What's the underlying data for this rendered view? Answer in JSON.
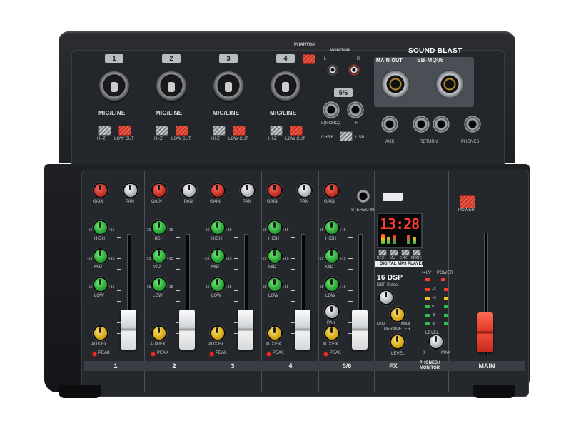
{
  "brand": {
    "name": "SOUND BLAST",
    "model": "SB-MQ06"
  },
  "channels": [
    {
      "number": "1",
      "strip_label": "1"
    },
    {
      "number": "2",
      "strip_label": "2"
    },
    {
      "number": "3",
      "strip_label": "3"
    },
    {
      "number": "4",
      "strip_label": "4"
    },
    {
      "number": "5/6",
      "strip_label": "5/6"
    }
  ],
  "top": {
    "mic_line": "MIC/LINE",
    "hi_z": "HI-Z",
    "low_cut": "LOW CUT",
    "phantom": "PHANTOM",
    "monitor": "MONITOR",
    "lr_l": "L",
    "lr_r": "R",
    "main_out": "MAIN OUT",
    "ch56": "CH5/6",
    "usb": "USB",
    "aux": "AUX",
    "return": "RETURN",
    "phones": "PHONES",
    "l_mono": "L(MONO)",
    "r": "R",
    "section_56": "5/6"
  },
  "knobs": {
    "gain": "GAIN",
    "pan": "PAN",
    "high": "HIGH",
    "mid": "MID",
    "low": "LOW",
    "aux_fx": "AUX/FX",
    "peak": "PEAK",
    "plus15": "+15",
    "minus15": "-15",
    "stereo_in": "STEREO IN",
    "power": "POWER"
  },
  "player": {
    "title": "DIGITAL MP3 PLAYER",
    "display_time": "13:28",
    "buttons": [
      "REC",
      "MU",
      "CHK",
      "MODE"
    ]
  },
  "dsp": {
    "title": "16 DSP",
    "select": "DSP Select",
    "parameter": "PARAMETER",
    "min": "MIN",
    "max": "MAX",
    "level": "LEVEL",
    "fx": "FX"
  },
  "meter": {
    "plus48v": "+48V",
    "power": "POWER",
    "levels": [
      "+5",
      "+3",
      "0",
      "-3",
      "-5"
    ],
    "phones_level": "LEVEL",
    "min": "0",
    "max": "MAX",
    "phones_monitor": "PHONES / MONITOR",
    "main": "MAIN"
  },
  "colors": {
    "chassis": "#1d1f22",
    "panel": "#24272b",
    "gain_knob": "#e23a27",
    "pan_knob": "#f2f2f2",
    "eq_knob": "#2fbf3f",
    "aux_knob": "#f2c21a",
    "main_fader": "#e23a27",
    "channel_fader": "#f2f2f2"
  }
}
